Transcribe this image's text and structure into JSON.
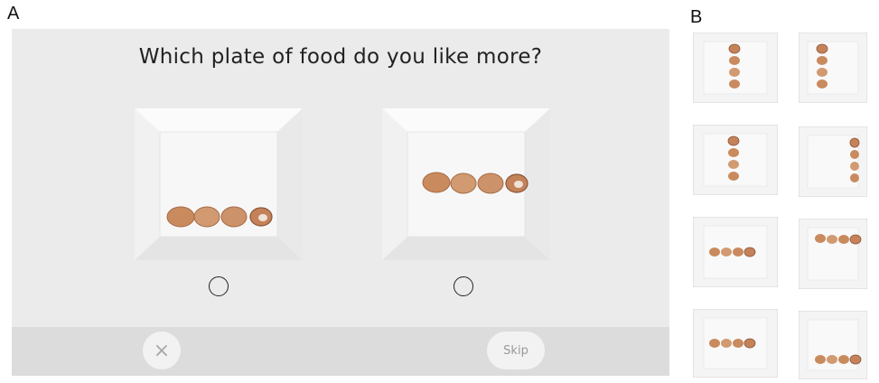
{
  "panels": {
    "a_label": "A",
    "b_label": "B"
  },
  "survey": {
    "question": "Which plate of food do you like more?",
    "options": [
      {
        "name": "left-plate",
        "arrangement": "horizontal-row-lower"
      },
      {
        "name": "right-plate",
        "arrangement": "horizontal-row-upper"
      }
    ],
    "close_icon": "×",
    "skip_label": "Skip"
  },
  "examples": {
    "thumbnails": [
      "vertical-center",
      "vertical-center",
      "vertical-center-left",
      "vertical-right",
      "horizontal-lower-left",
      "horizontal-upper-right",
      "horizontal-lower-left",
      "horizontal-lower-right"
    ]
  },
  "colors": {
    "background": "#ebebeb",
    "footer": "#dcdcdc",
    "plate": "#f7f7f7",
    "food": "#c98a5e"
  }
}
